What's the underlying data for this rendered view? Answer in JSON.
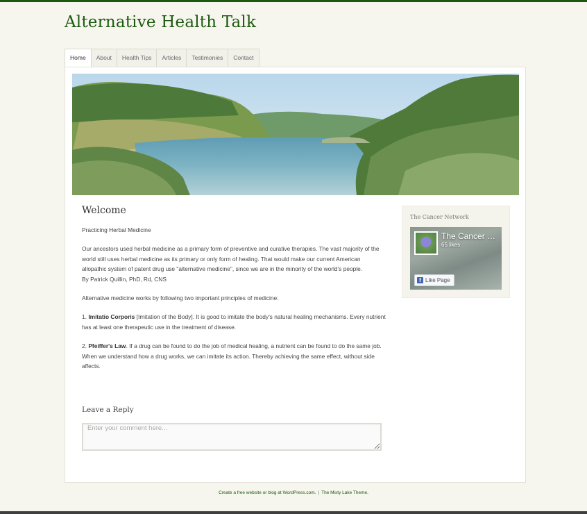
{
  "site": {
    "title": "Alternative Health Talk",
    "accent_color": "#1d5a10"
  },
  "nav": {
    "items": [
      "Home",
      "About",
      "Health Tips",
      "Articles",
      "Testimonies",
      "Contact"
    ],
    "active": "Home"
  },
  "hero": {
    "image_name": "lake-landscape-banner"
  },
  "post": {
    "title": "Welcome",
    "subtitle": "Practicing Herbal Medicine",
    "para1": "Our ancestors used herbal medicine as a primary form of preventive and curative therapies. The vast majority of the world still uses herbal medicine as its primary or only form of healing. That would make our current American allopathic system of patent drug use \"alternative medicine\", since we are in the minority of the world's people.",
    "byline": "By Patrick Quillin, PhD, Rd, CNS",
    "para2": "Alternative medicine works by following two important principles of medicine:",
    "principle1_num": "1.",
    "principle1_bold": "Imitatio Corporis",
    "principle1_text": "[Imitation of the Body]. It is good to imitate the body's natural healing mechanisms. Every nutrient has at least one therapeutic use in the treatment of disease.",
    "principle2_num": "2.",
    "principle2_bold": "Pfeiffer's Law",
    "principle2_text": ". If a drug can be found to do the job of medical healing, a nutrient can be found to do the same job. When we understand how a drug works, we can imitate its action. Thereby achieving the same effect, without side affects."
  },
  "reply": {
    "title": "Leave a Reply",
    "placeholder": "Enter your comment here..."
  },
  "widget": {
    "title": "The Cancer Network",
    "page_name": "The Cancer Network",
    "likes": "65 likes",
    "like_button": "Like Page",
    "icon": "facebook-icon"
  },
  "footer": {
    "link1": "Create a free website or blog at WordPress.com.",
    "separator": "|",
    "link2": "The Misty Lake Theme."
  }
}
